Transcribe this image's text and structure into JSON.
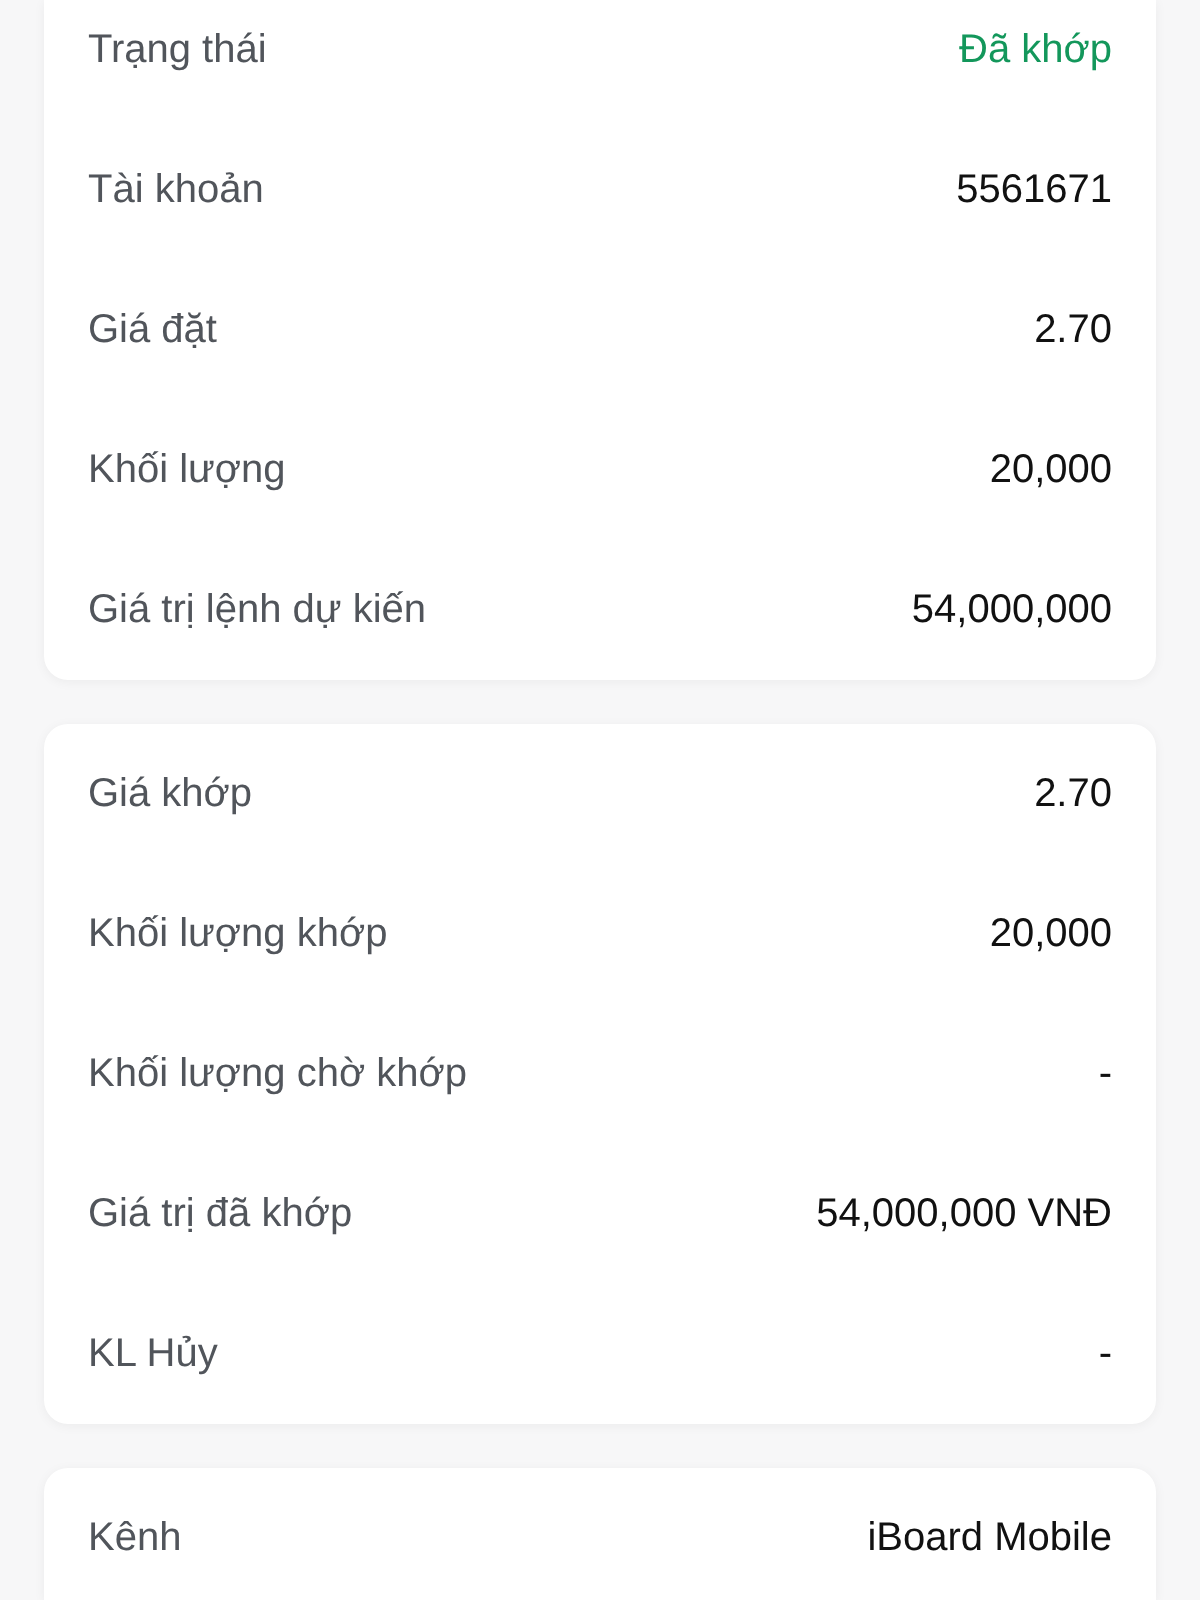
{
  "sections": [
    {
      "rows": [
        {
          "label": "Trạng thái",
          "value": "Đã khớp",
          "kind": "status"
        },
        {
          "label": "Tài khoản",
          "value": "5561671",
          "kind": "text"
        },
        {
          "label": "Giá đặt",
          "value": "2.70",
          "kind": "text"
        },
        {
          "label": "Khối lượng",
          "value": "20,000",
          "kind": "text"
        },
        {
          "label": "Giá trị lệnh dự kiến",
          "value": "54,000,000",
          "kind": "text"
        }
      ]
    },
    {
      "rows": [
        {
          "label": "Giá khớp",
          "value": "2.70",
          "kind": "text"
        },
        {
          "label": "Khối lượng khớp",
          "value": "20,000",
          "kind": "text"
        },
        {
          "label": "Khối lượng chờ khớp",
          "value": "-",
          "kind": "text"
        },
        {
          "label": "Giá trị đã khớp",
          "value": "54,000,000 VNĐ",
          "kind": "text"
        },
        {
          "label": "KL Hủy",
          "value": "-",
          "kind": "text"
        }
      ]
    },
    {
      "rows": [
        {
          "label": "Kênh",
          "value": "iBoard Mobile",
          "kind": "text"
        }
      ]
    }
  ]
}
